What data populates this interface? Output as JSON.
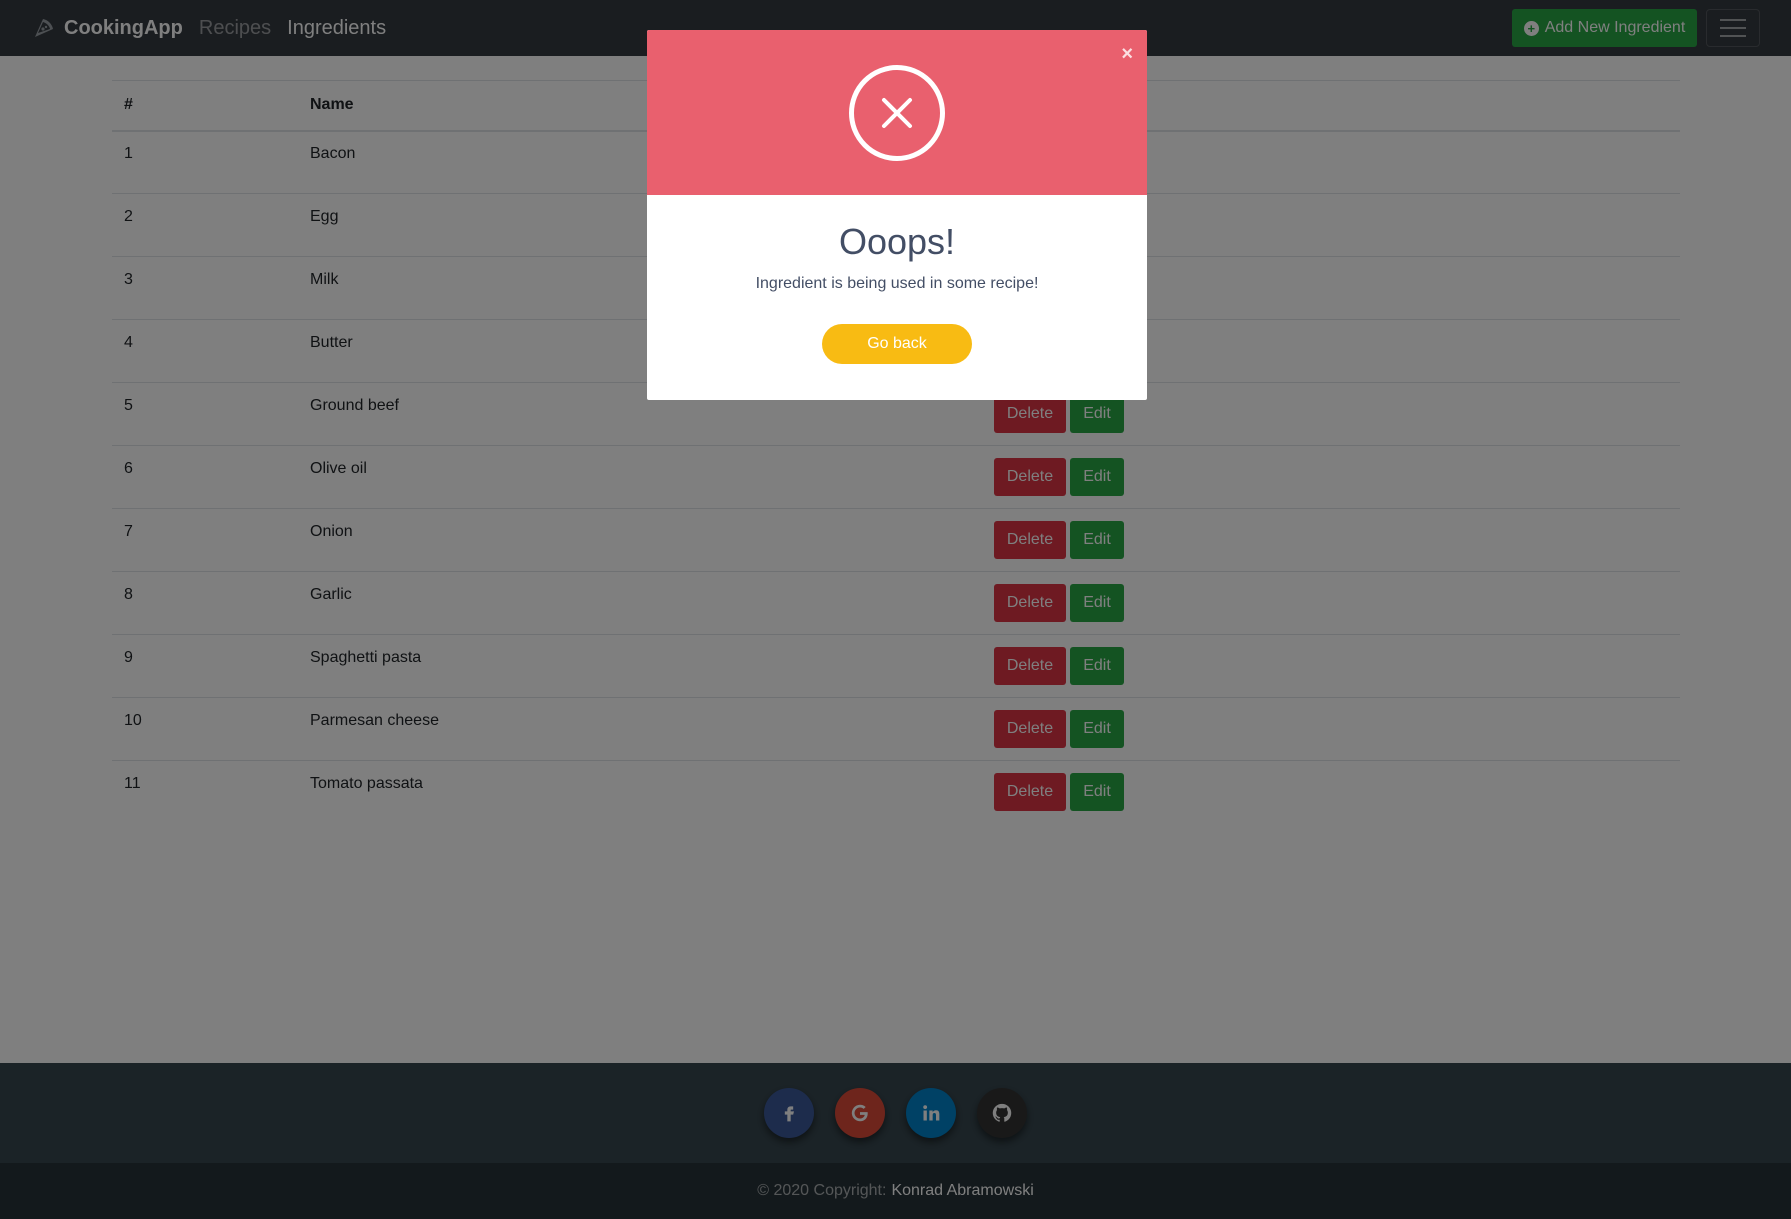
{
  "navbar": {
    "brand": "CookingApp",
    "links": [
      "Recipes",
      "Ingredients"
    ],
    "add_button": "Add New Ingredient"
  },
  "table": {
    "headers": [
      "#",
      "Name"
    ],
    "rows": [
      {
        "num": "1",
        "name": "Bacon"
      },
      {
        "num": "2",
        "name": "Egg"
      },
      {
        "num": "3",
        "name": "Milk"
      },
      {
        "num": "4",
        "name": "Butter"
      },
      {
        "num": "5",
        "name": "Ground beef"
      },
      {
        "num": "6",
        "name": "Olive oil"
      },
      {
        "num": "7",
        "name": "Onion"
      },
      {
        "num": "8",
        "name": "Garlic"
      },
      {
        "num": "9",
        "name": "Spaghetti pasta"
      },
      {
        "num": "10",
        "name": "Parmesan cheese"
      },
      {
        "num": "11",
        "name": "Tomato passata"
      }
    ],
    "delete_label": "Delete",
    "edit_label": "Edit"
  },
  "modal": {
    "title": "Ooops!",
    "message": "Ingredient is being used in some recipe!",
    "button": "Go back",
    "close": "×"
  },
  "footer": {
    "social": [
      "facebook-icon",
      "google-icon",
      "linkedin-icon",
      "github-icon"
    ],
    "copyright": "© 2020 Copyright:",
    "author": "Konrad Abramowski"
  },
  "colors": {
    "navbar": "#343a40",
    "success": "#28a745",
    "danger": "#dc3545",
    "modal_header": "#e9606e",
    "modal_button": "#f8bb13"
  }
}
